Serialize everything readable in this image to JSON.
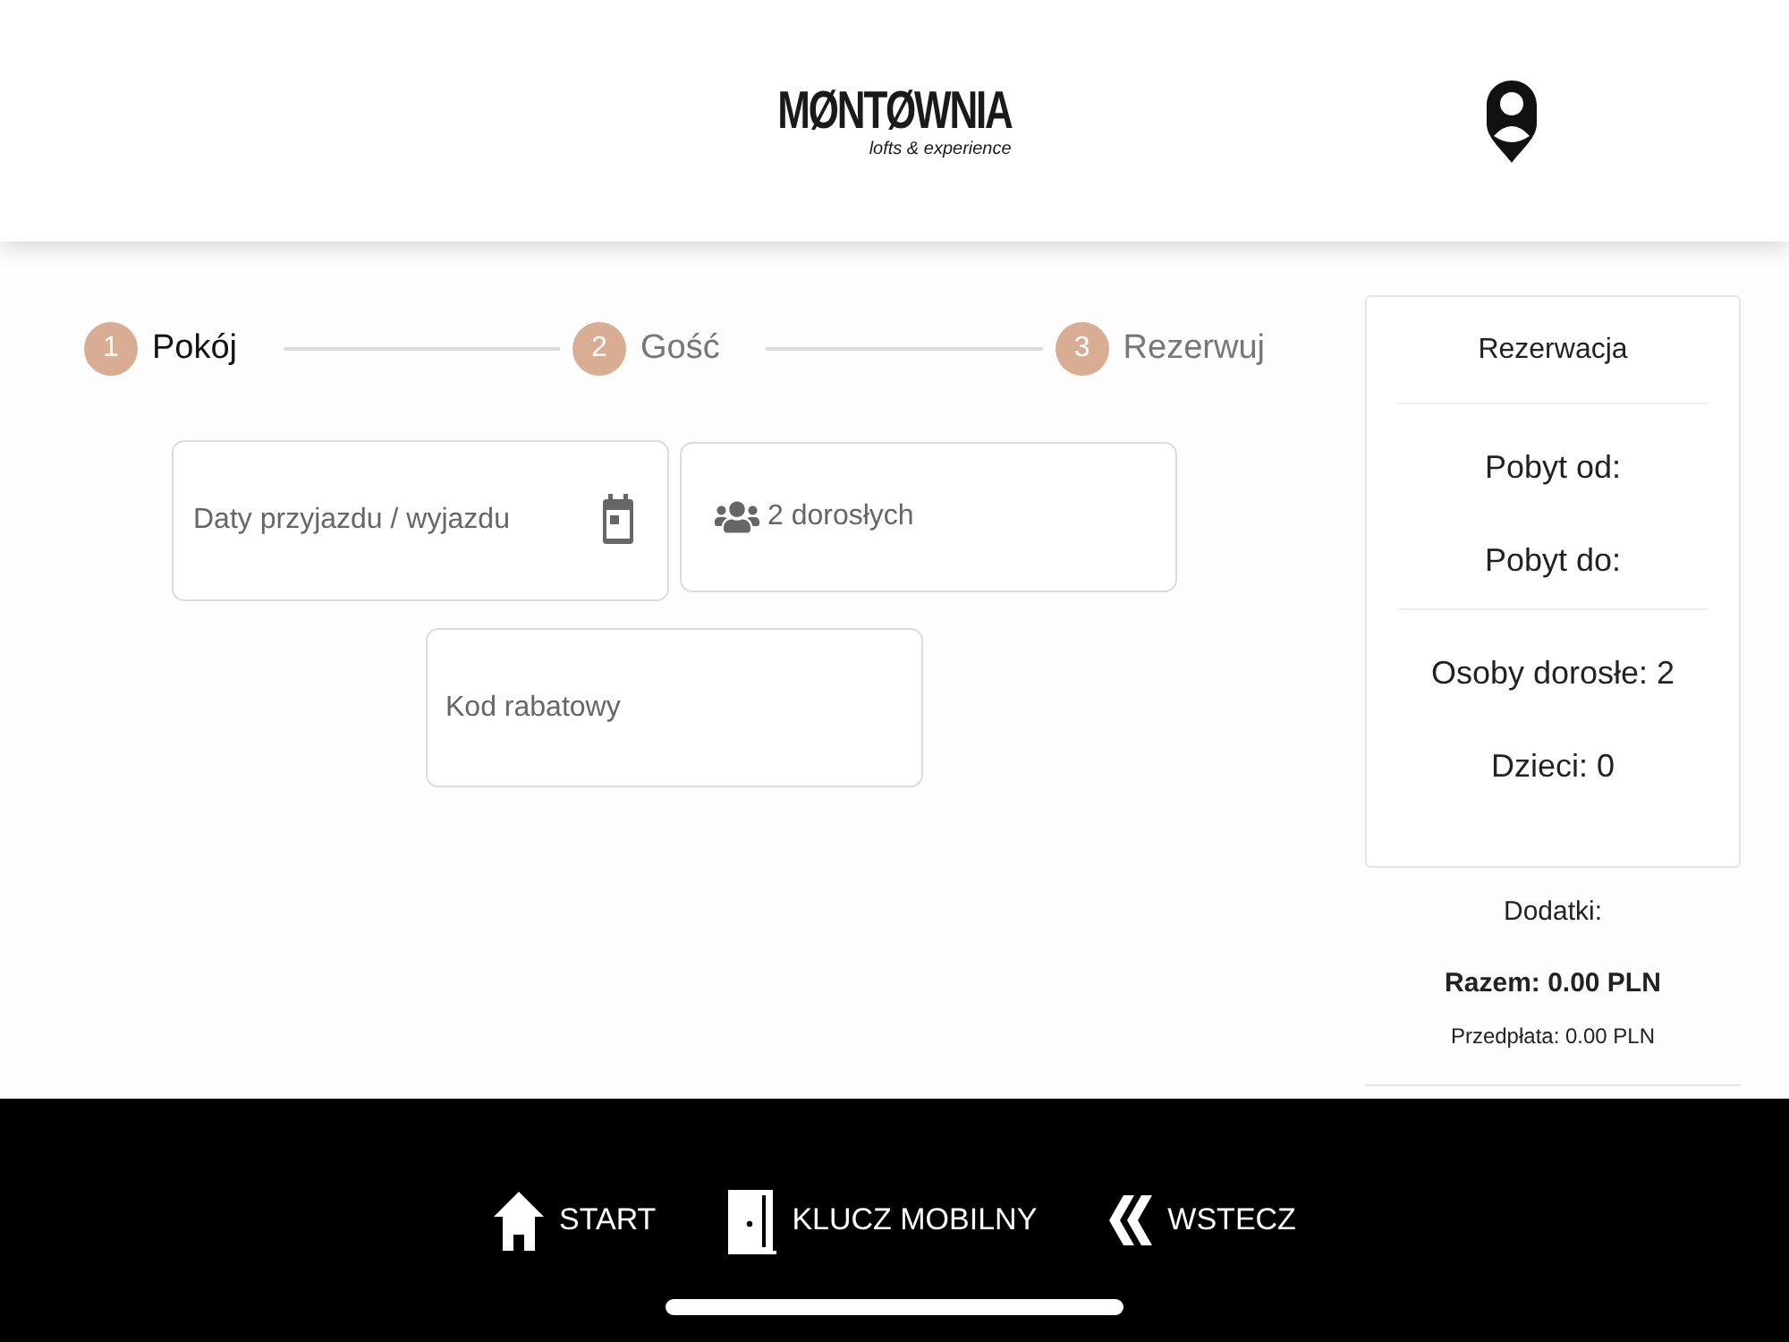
{
  "header": {
    "logo": {
      "name": "MØNTØWNIA",
      "tagline": "lofts & experience"
    }
  },
  "stepper": {
    "steps": [
      {
        "number": "1",
        "label": "Pokój",
        "selected": true
      },
      {
        "number": "2",
        "label": "Gość",
        "selected": false
      },
      {
        "number": "3",
        "label": "Rezerwuj",
        "selected": false
      }
    ]
  },
  "form": {
    "fields": [
      {
        "kind": "date",
        "placeholder": "Daty przyjazdu / wyjazdu"
      },
      {
        "kind": "guests",
        "value": "2 dorosłych"
      },
      {
        "kind": "text",
        "placeholder": "Kod rabatowy"
      }
    ]
  },
  "summary": {
    "title": "Rezerwacja",
    "groups": [
      [
        "Pobyt od:",
        "Pobyt do:"
      ],
      [
        "Osoby dorosłe: 2",
        "Dzieci: 0"
      ]
    ],
    "extras": "Dodatki:",
    "total": "Razem: 0.00 PLN",
    "prepayment": "Przedpłata: 0.00 PLN"
  },
  "bottom_nav": {
    "items": [
      {
        "kind": "home",
        "label": "START"
      },
      {
        "kind": "door",
        "label": "KLUCZ MOBILNY"
      },
      {
        "kind": "back",
        "label": "WSTECZ"
      }
    ]
  }
}
